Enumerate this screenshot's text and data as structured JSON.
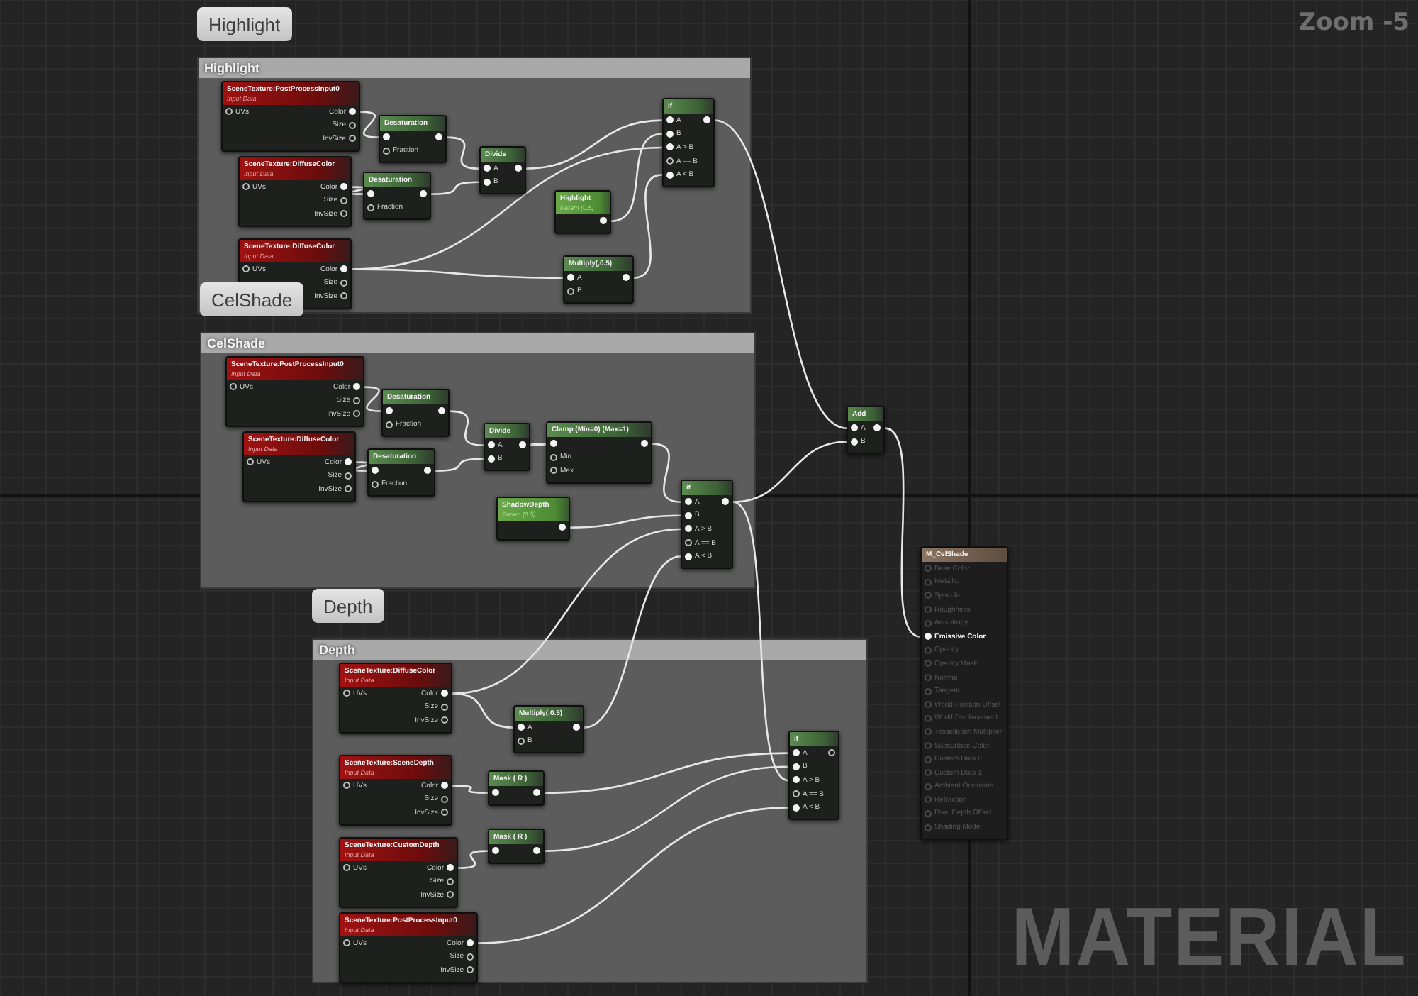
{
  "zoom_label": "Zoom -5",
  "watermark": "MATERIAL",
  "comments": [
    {
      "bubble": "Highlight",
      "title": "Highlight",
      "nodes": [
        {
          "kind": "texture",
          "title": "SceneTexture:PostProcessInput0",
          "subtitle": "Input Data",
          "inputs": [
            {
              "label": "UVs",
              "connected": false
            }
          ],
          "outputs": [
            {
              "label": "Color",
              "connected": true
            },
            {
              "label": "Size",
              "connected": false
            },
            {
              "label": "InvSize",
              "connected": false
            }
          ]
        },
        {
          "kind": "function",
          "title": "Desaturation",
          "inputs": [
            {
              "connected": true
            },
            {
              "label": "Fraction",
              "connected": false
            }
          ],
          "outputs": [
            {
              "connected": true
            }
          ]
        },
        {
          "kind": "texture",
          "title": "SceneTexture:DiffuseColor",
          "subtitle": "Input Data",
          "inputs": [
            {
              "label": "UVs",
              "connected": false
            }
          ],
          "outputs": [
            {
              "label": "Color",
              "connected": true
            },
            {
              "label": "Size",
              "connected": false
            },
            {
              "label": "InvSize",
              "connected": false
            }
          ]
        },
        {
          "kind": "function",
          "title": "Desaturation",
          "inputs": [
            {
              "connected": true
            },
            {
              "label": "Fraction",
              "connected": false
            }
          ],
          "outputs": [
            {
              "connected": true
            }
          ]
        },
        {
          "kind": "function",
          "title": "Divide",
          "inputs": [
            {
              "label": "A",
              "connected": true
            },
            {
              "label": "B",
              "connected": true
            }
          ],
          "outputs": [
            {
              "connected": true
            }
          ]
        },
        {
          "kind": "function",
          "title": "if",
          "inputs": [
            {
              "label": "A",
              "connected": true
            },
            {
              "label": "B",
              "connected": true
            },
            {
              "label": "A > B",
              "connected": true
            },
            {
              "label": "A == B",
              "connected": false
            },
            {
              "label": "A < B",
              "connected": true
            }
          ],
          "outputs": [
            {
              "connected": true
            }
          ]
        },
        {
          "kind": "param",
          "title": "Highlight",
          "subtitle": "Param (0.5)",
          "outputs": [
            {
              "connected": true
            }
          ]
        },
        {
          "kind": "texture",
          "title": "SceneTexture:DiffuseColor",
          "subtitle": "Input Data",
          "inputs": [
            {
              "label": "UVs",
              "connected": false
            }
          ],
          "outputs": [
            {
              "label": "Color",
              "connected": true
            },
            {
              "label": "Size",
              "connected": false
            },
            {
              "label": "InvSize",
              "connected": false
            }
          ]
        },
        {
          "kind": "function",
          "title": "Multiply(,0.5)",
          "inputs": [
            {
              "label": "A",
              "connected": true
            },
            {
              "label": "B",
              "connected": false
            }
          ],
          "outputs": [
            {
              "connected": true
            }
          ]
        }
      ]
    },
    {
      "bubble": "CelShade",
      "title": "CelShade",
      "nodes": [
        {
          "kind": "texture",
          "title": "SceneTexture:PostProcessInput0",
          "subtitle": "Input Data",
          "inputs": [
            {
              "label": "UVs",
              "connected": false
            }
          ],
          "outputs": [
            {
              "label": "Color",
              "connected": true
            },
            {
              "label": "Size",
              "connected": false
            },
            {
              "label": "InvSize",
              "connected": false
            }
          ]
        },
        {
          "kind": "function",
          "title": "Desaturation",
          "inputs": [
            {
              "connected": true
            },
            {
              "label": "Fraction",
              "connected": false
            }
          ],
          "outputs": [
            {
              "connected": true
            }
          ]
        },
        {
          "kind": "texture",
          "title": "SceneTexture:DiffuseColor",
          "subtitle": "Input Data",
          "inputs": [
            {
              "label": "UVs",
              "connected": false
            }
          ],
          "outputs": [
            {
              "label": "Color",
              "connected": true
            },
            {
              "label": "Size",
              "connected": false
            },
            {
              "label": "InvSize",
              "connected": false
            }
          ]
        },
        {
          "kind": "function",
          "title": "Desaturation",
          "inputs": [
            {
              "connected": true
            },
            {
              "label": "Fraction",
              "connected": false
            }
          ],
          "outputs": [
            {
              "connected": true
            }
          ]
        },
        {
          "kind": "function",
          "title": "Divide",
          "inputs": [
            {
              "label": "A",
              "connected": true
            },
            {
              "label": "B",
              "connected": true
            }
          ],
          "outputs": [
            {
              "connected": true
            }
          ]
        },
        {
          "kind": "function",
          "title": "Clamp (Min=0) (Max=1)",
          "inputs": [
            {
              "connected": true
            },
            {
              "label": "Min",
              "connected": false
            },
            {
              "label": "Max",
              "connected": false
            }
          ],
          "outputs": [
            {
              "connected": true
            }
          ]
        },
        {
          "kind": "param",
          "title": "ShadowDepth",
          "subtitle": "Param (0.5)",
          "outputs": [
            {
              "connected": true
            }
          ]
        },
        {
          "kind": "function",
          "title": "if",
          "inputs": [
            {
              "label": "A",
              "connected": true
            },
            {
              "label": "B",
              "connected": true
            },
            {
              "label": "A > B",
              "connected": true
            },
            {
              "label": "A == B",
              "connected": false
            },
            {
              "label": "A < B",
              "connected": true
            }
          ],
          "outputs": [
            {
              "connected": true
            }
          ]
        }
      ]
    },
    {
      "bubble": "Depth",
      "title": "Depth",
      "nodes": [
        {
          "kind": "texture",
          "title": "SceneTexture:DiffuseColor",
          "subtitle": "Input Data",
          "inputs": [
            {
              "label": "UVs",
              "connected": false
            }
          ],
          "outputs": [
            {
              "label": "Color",
              "connected": true
            },
            {
              "label": "Size",
              "connected": false
            },
            {
              "label": "InvSize",
              "connected": false
            }
          ]
        },
        {
          "kind": "function",
          "title": "Multiply(,0.5)",
          "inputs": [
            {
              "label": "A",
              "connected": true
            },
            {
              "label": "B",
              "connected": false
            }
          ],
          "outputs": [
            {
              "connected": true
            }
          ]
        },
        {
          "kind": "texture",
          "title": "SceneTexture:SceneDepth",
          "subtitle": "Input Data",
          "inputs": [
            {
              "label": "UVs",
              "connected": false
            }
          ],
          "outputs": [
            {
              "label": "Color",
              "connected": true
            },
            {
              "label": "Size",
              "connected": false
            },
            {
              "label": "InvSize",
              "connected": false
            }
          ]
        },
        {
          "kind": "function",
          "title": "Mask ( R )",
          "inputs": [
            {
              "connected": true
            }
          ],
          "outputs": [
            {
              "connected": true
            }
          ]
        },
        {
          "kind": "texture",
          "title": "SceneTexture:CustomDepth",
          "subtitle": "Input Data",
          "inputs": [
            {
              "label": "UVs",
              "connected": false
            }
          ],
          "outputs": [
            {
              "label": "Color",
              "connected": true
            },
            {
              "label": "Size",
              "connected": false
            },
            {
              "label": "InvSize",
              "connected": false
            }
          ]
        },
        {
          "kind": "function",
          "title": "Mask ( R )",
          "inputs": [
            {
              "connected": true
            }
          ],
          "outputs": [
            {
              "connected": true
            }
          ]
        },
        {
          "kind": "texture",
          "title": "SceneTexture:PostProcessInput0",
          "subtitle": "Input Data",
          "inputs": [
            {
              "label": "UVs",
              "connected": false
            }
          ],
          "outputs": [
            {
              "label": "Color",
              "connected": true
            },
            {
              "label": "Size",
              "connected": false
            },
            {
              "label": "InvSize",
              "connected": false
            }
          ]
        },
        {
          "kind": "function",
          "title": "if",
          "inputs": [
            {
              "label": "A",
              "connected": true
            },
            {
              "label": "B",
              "connected": true
            },
            {
              "label": "A > B",
              "connected": true
            },
            {
              "label": "A == B",
              "connected": false
            },
            {
              "label": "A < B",
              "connected": true
            }
          ],
          "outputs": [
            {
              "connected": false
            }
          ]
        }
      ]
    }
  ],
  "nodes": [
    {
      "kind": "function",
      "title": "Add",
      "inputs": [
        {
          "label": "A",
          "connected": true
        },
        {
          "label": "B",
          "connected": true
        }
      ],
      "outputs": [
        {
          "connected": true
        }
      ]
    },
    {
      "kind": "result",
      "title": "M_CelShade",
      "inputs": [
        {
          "label": "Base Color",
          "connected": false
        },
        {
          "label": "Metallic",
          "connected": false
        },
        {
          "label": "Specular",
          "connected": false
        },
        {
          "label": "Roughness",
          "connected": false
        },
        {
          "label": "Anisotropy",
          "connected": false
        },
        {
          "label": "Emissive Color",
          "connected": true
        },
        {
          "label": "Opacity",
          "connected": false
        },
        {
          "label": "Opacity Mask",
          "connected": false
        },
        {
          "label": "Normal",
          "connected": false
        },
        {
          "label": "Tangent",
          "connected": false
        },
        {
          "label": "World Position Offset",
          "connected": false
        },
        {
          "label": "World Displacement",
          "connected": false
        },
        {
          "label": "Tessellation Multiplier",
          "connected": false
        },
        {
          "label": "Subsurface Color",
          "connected": false
        },
        {
          "label": "Custom Data 0",
          "connected": false
        },
        {
          "label": "Custom Data 1",
          "connected": false
        },
        {
          "label": "Ambient Occlusion",
          "connected": false
        },
        {
          "label": "Refraction",
          "connected": false
        },
        {
          "label": "Pixel Depth Offset",
          "connected": false
        },
        {
          "label": "Shading Model",
          "connected": false
        }
      ]
    }
  ]
}
